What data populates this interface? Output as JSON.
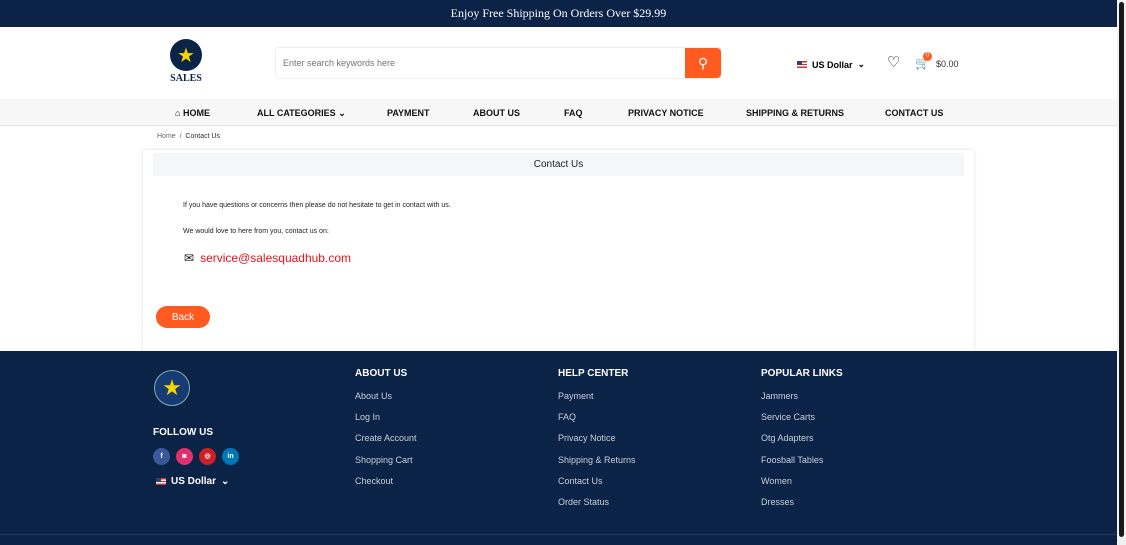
{
  "topbar": {
    "text": "Enjoy Free Shipping On Orders Over $29.99"
  },
  "header": {
    "logo_text": "SALES",
    "search_placeholder": "Enter search keywords here",
    "currency": "US Dollar",
    "cart_count": "0",
    "cart_total": "$0.00"
  },
  "nav": {
    "items": [
      "HOME",
      "ALL CATEGORIES",
      "PAYMENT",
      "ABOUT US",
      "FAQ",
      "PRIVACY NOTICE",
      "SHIPPING & RETURNS",
      "CONTACT US"
    ]
  },
  "breadcrumb": {
    "home": "Home",
    "sep": "/",
    "current": "Contact Us"
  },
  "content": {
    "title": "Contact Us",
    "para1": "If you have questions or concerns then please do not hesitate to get in contact with us.",
    "para2": "We would love to here from you, contact us on:",
    "email": "service@salesquadhub.com",
    "back": "Back"
  },
  "footer": {
    "follow": "FOLLOW US",
    "currency": "US Dollar",
    "social": [
      {
        "icon": "facebook-icon",
        "glyph": "f",
        "color": "#3b5998"
      },
      {
        "icon": "instagram-icon",
        "glyph": "◙",
        "color": "#e1306c"
      },
      {
        "icon": "pinterest-icon",
        "glyph": "◎",
        "color": "#cb2027"
      },
      {
        "icon": "linkedin-icon",
        "glyph": "in",
        "color": "#0077b5"
      }
    ],
    "columns": [
      {
        "title": "ABOUT US",
        "links": [
          "About Us",
          "Log In",
          "Create Account",
          "Shopping Cart",
          "Checkout"
        ]
      },
      {
        "title": "HELP CENTER",
        "links": [
          "Payment",
          "FAQ",
          "Privacy Notice",
          "Shipping & Returns",
          "Contact Us",
          "Order Status"
        ]
      },
      {
        "title": "POPULAR LINKS",
        "links": [
          "Jammers",
          "Service Carts",
          "Otg Adapters",
          "Foosball Tables",
          "Women",
          "Dresses"
        ]
      }
    ]
  },
  "colors": {
    "navy": "#0b2347",
    "accent": "#ff5a1f",
    "email": "#e8121c"
  }
}
